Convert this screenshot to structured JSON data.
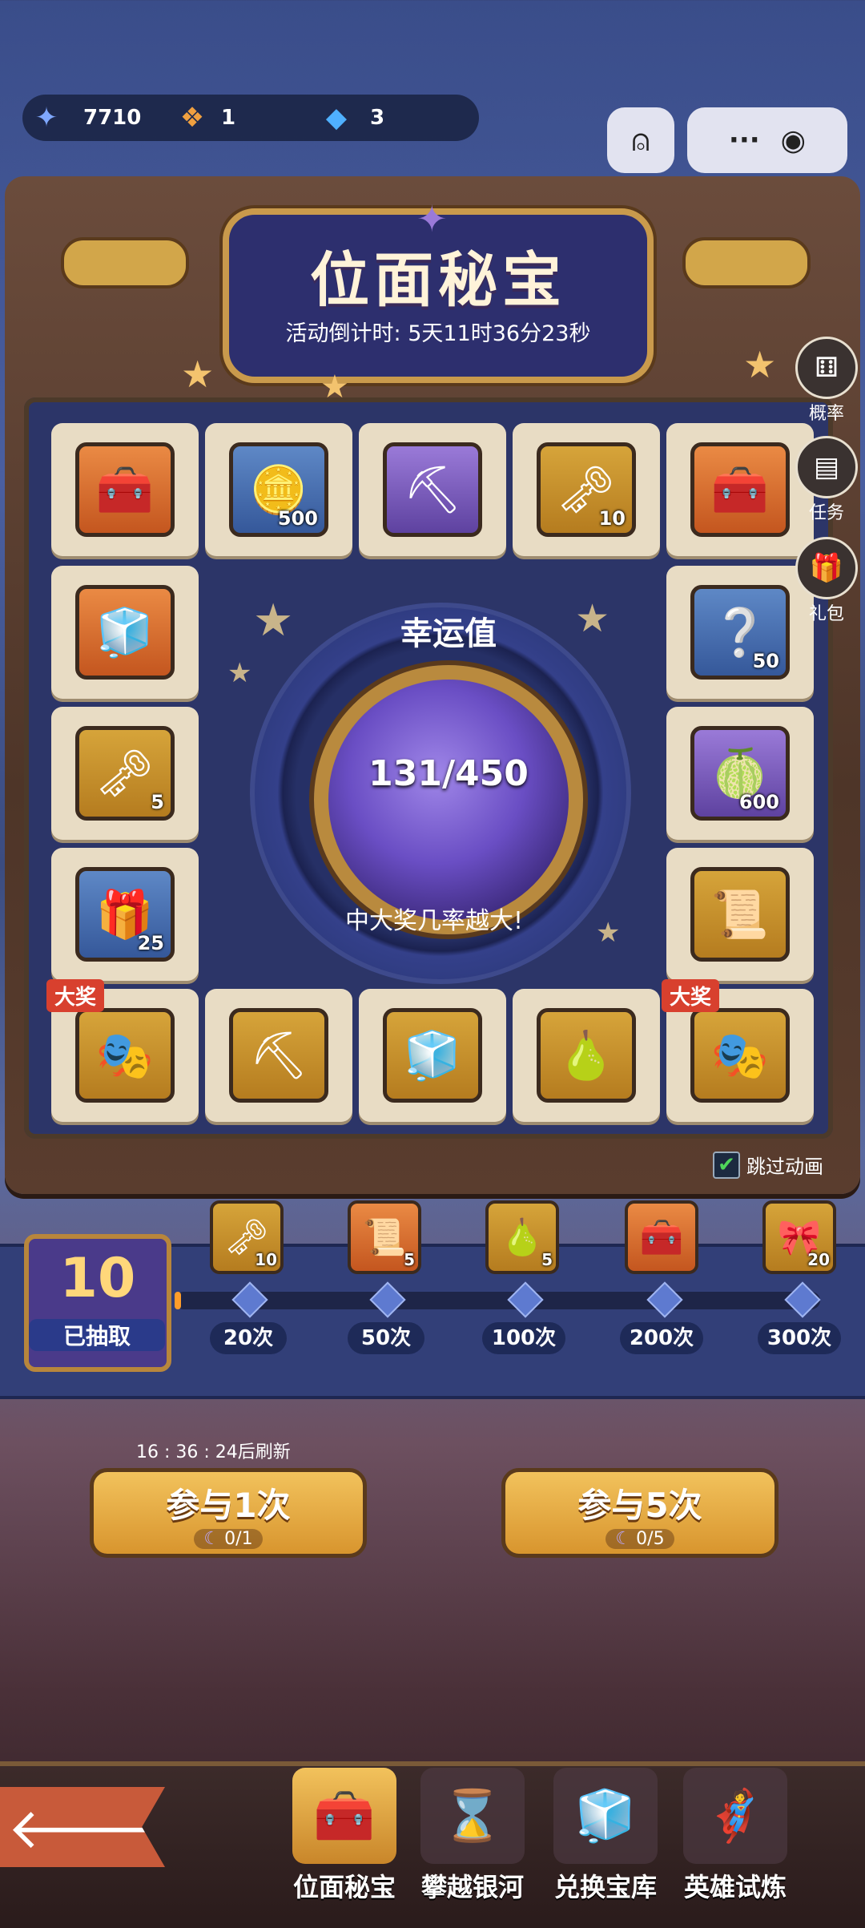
{
  "resources": {
    "stars": "7710",
    "cubes": "1",
    "blue_boxes": "3"
  },
  "event": {
    "title": "位面秘宝",
    "countdown_label": "活动倒计时:",
    "countdown_value": "5天11时36分23秒"
  },
  "side_buttons": {
    "probability": "概率",
    "tasks": "任务",
    "gift": "礼包"
  },
  "board": {
    "big_prize_tag": "大奖",
    "top_row": [
      {
        "icon": "treasure-chest-icon",
        "qty": ""
      },
      {
        "icon": "gold-coin-icon",
        "qty": "500"
      },
      {
        "icon": "pickaxe-icon",
        "qty": ""
      },
      {
        "icon": "gold-key-icon",
        "qty": "10"
      },
      {
        "icon": "treasure-chest-icon",
        "qty": ""
      }
    ],
    "left_col": [
      {
        "icon": "cubes-icon",
        "qty": ""
      },
      {
        "icon": "gold-key-icon",
        "qty": "5"
      },
      {
        "icon": "mystery-chest-icon",
        "qty": "25"
      }
    ],
    "right_col": [
      {
        "icon": "mystery-stone-icon",
        "qty": "50"
      },
      {
        "icon": "green-fruit-icon",
        "qty": "600"
      },
      {
        "icon": "scroll-icon",
        "qty": ""
      }
    ],
    "bottom_row": [
      {
        "icon": "hero-bundle-icon",
        "qty": "",
        "big_prize": true
      },
      {
        "icon": "golden-pickaxe-icon",
        "qty": ""
      },
      {
        "icon": "blue-box-icon",
        "qty": ""
      },
      {
        "icon": "golden-fruit-icon",
        "qty": ""
      },
      {
        "icon": "hero-bundle-icon",
        "qty": "",
        "big_prize": true
      }
    ]
  },
  "lucky": {
    "title": "幸运值",
    "value": "131/450",
    "current": 131,
    "max": 450,
    "subtitle": "中大奖几率越大!"
  },
  "skip_animation": {
    "label": "跳过动画",
    "checked": true
  },
  "progress": {
    "drawn_count": "10",
    "drawn_label": "已抽取",
    "fraction": 0.01,
    "milestones": [
      {
        "label": "20次",
        "reward_icon": "gold-key-icon",
        "qty": "10"
      },
      {
        "label": "50次",
        "reward_icon": "scroll-icon",
        "qty": "5"
      },
      {
        "label": "100次",
        "reward_icon": "golden-fruit-icon",
        "qty": "5"
      },
      {
        "label": "200次",
        "reward_icon": "treasure-chest-icon",
        "qty": ""
      },
      {
        "label": "300次",
        "reward_icon": "blue-flower-icon",
        "qty": "20"
      }
    ]
  },
  "refresh_text": "16 : 36 : 24后刷新",
  "actions": {
    "once": {
      "label": "参与1次",
      "cost": "0/1"
    },
    "five": {
      "label": "参与5次",
      "cost": "0/5"
    }
  },
  "nav": [
    {
      "label": "位面秘宝",
      "icon": "treasure-box-icon",
      "active": true
    },
    {
      "label": "攀越银河",
      "icon": "hourglass-icon",
      "active": false
    },
    {
      "label": "兑换宝库",
      "icon": "cube-stack-icon",
      "active": false
    },
    {
      "label": "英雄试炼",
      "icon": "hero-icon",
      "active": false
    }
  ],
  "colors": {
    "accent_gold": "#d8952e",
    "progress_fill": "#ff9d2a",
    "big_prize_red": "#d8402e"
  }
}
